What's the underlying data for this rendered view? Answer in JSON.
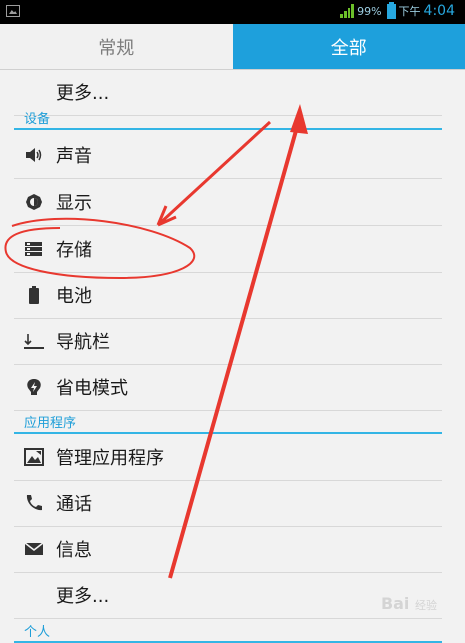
{
  "status_bar": {
    "battery_percent": "99%",
    "time_prefix": "下午",
    "time": "4:04"
  },
  "tabs": [
    {
      "label": "常规"
    },
    {
      "label": "全部"
    }
  ],
  "top_more": {
    "label": "更多..."
  },
  "sections": [
    {
      "title": "设备",
      "items": [
        {
          "label": "声音",
          "icon": "speaker-icon"
        },
        {
          "label": "显示",
          "icon": "brightness-icon"
        },
        {
          "label": "存储",
          "icon": "storage-icon"
        },
        {
          "label": "电池",
          "icon": "battery-icon"
        },
        {
          "label": "导航栏",
          "icon": "navigation-bar-icon"
        },
        {
          "label": "省电模式",
          "icon": "power-saving-icon"
        }
      ]
    },
    {
      "title": "应用程序",
      "items": [
        {
          "label": "管理应用程序",
          "icon": "apps-icon"
        },
        {
          "label": "通话",
          "icon": "phone-icon"
        },
        {
          "label": "信息",
          "icon": "message-icon"
        },
        {
          "label": "更多...",
          "icon": ""
        }
      ]
    },
    {
      "title": "个人"
    }
  ],
  "colors": {
    "accent": "#1ea0dc",
    "annotation": "#e8382f"
  },
  "watermark": {
    "text": "Bai",
    "suffix": "经验"
  }
}
